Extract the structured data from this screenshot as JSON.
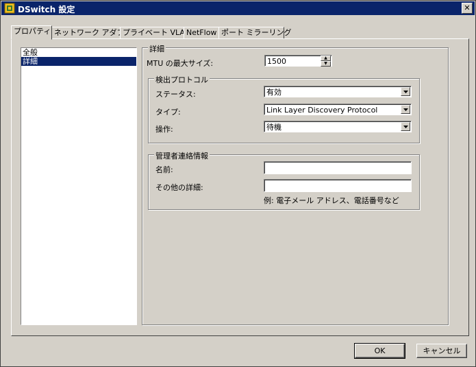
{
  "window": {
    "title": "DSwitch 設定",
    "close_label": "✕"
  },
  "tabs": [
    {
      "label": "プロパティ"
    },
    {
      "label": "ネットワーク アダプタ"
    },
    {
      "label": "プライベート VLAN"
    },
    {
      "label": "NetFlow"
    },
    {
      "label": "ポート ミラーリング"
    }
  ],
  "sidebar": {
    "items": [
      {
        "label": "全般"
      },
      {
        "label": "詳細"
      }
    ]
  },
  "advanced": {
    "section_title": "詳細",
    "mtu_label": "MTU の最大サイズ:",
    "mtu_value": "1500",
    "discovery": {
      "legend": "検出プロトコル",
      "status_label": "ステータス:",
      "status_value": "有効",
      "type_label": "タイプ:",
      "type_value": "Link Layer Discovery Protocol",
      "operation_label": "操作:",
      "operation_value": "待機"
    },
    "admin": {
      "legend": "管理者連絡情報",
      "name_label": "名前:",
      "name_value": "",
      "details_label": "その他の詳細:",
      "details_value": "",
      "hint": "例: 電子メール アドレス、電話番号など"
    }
  },
  "buttons": {
    "ok": "OK",
    "cancel": "キャンセル"
  }
}
